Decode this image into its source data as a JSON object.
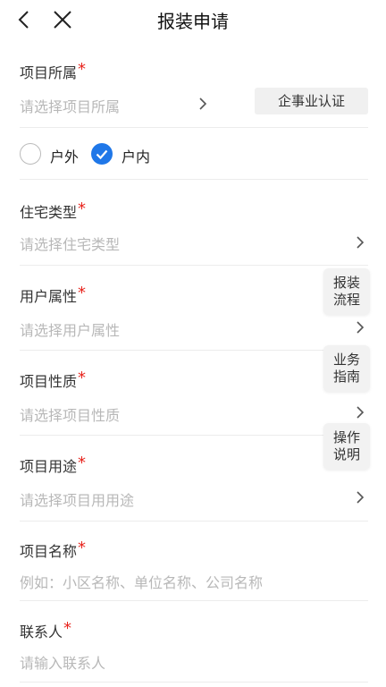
{
  "header": {
    "title": "报装申请"
  },
  "project_owner": {
    "label": "项目所属",
    "required_mark": "*",
    "placeholder": "请选择项目所属",
    "cert_button": "企事业认证"
  },
  "location": {
    "outdoor": "户外",
    "indoor": "户内",
    "selected": "户内"
  },
  "housing_type": {
    "label": "住宅类型",
    "required_mark": "*",
    "placeholder": "请选择住宅类型"
  },
  "user_attribute": {
    "label": "用户属性",
    "required_mark": "*",
    "placeholder": "请选择用户属性"
  },
  "project_nature": {
    "label": "项目性质",
    "required_mark": "*",
    "placeholder": "请选择项目性质"
  },
  "project_usage": {
    "label": "项目用途",
    "required_mark": "*",
    "placeholder": "请选择项目用用途"
  },
  "project_name": {
    "label": "项目名称",
    "required_mark": "*",
    "placeholder": "例如：小区名称、单位名称、公司名称"
  },
  "contact": {
    "label": "联系人",
    "required_mark": "*",
    "placeholder": "请输入联系人"
  },
  "float_buttons": {
    "process": [
      "报装",
      "流程"
    ],
    "guide": [
      "业务",
      "指南"
    ],
    "instructions": [
      "操作",
      "说明"
    ]
  },
  "colors": {
    "accent": "#1f77e8",
    "required": "#e8251e",
    "placeholder": "#b8b8b8"
  }
}
